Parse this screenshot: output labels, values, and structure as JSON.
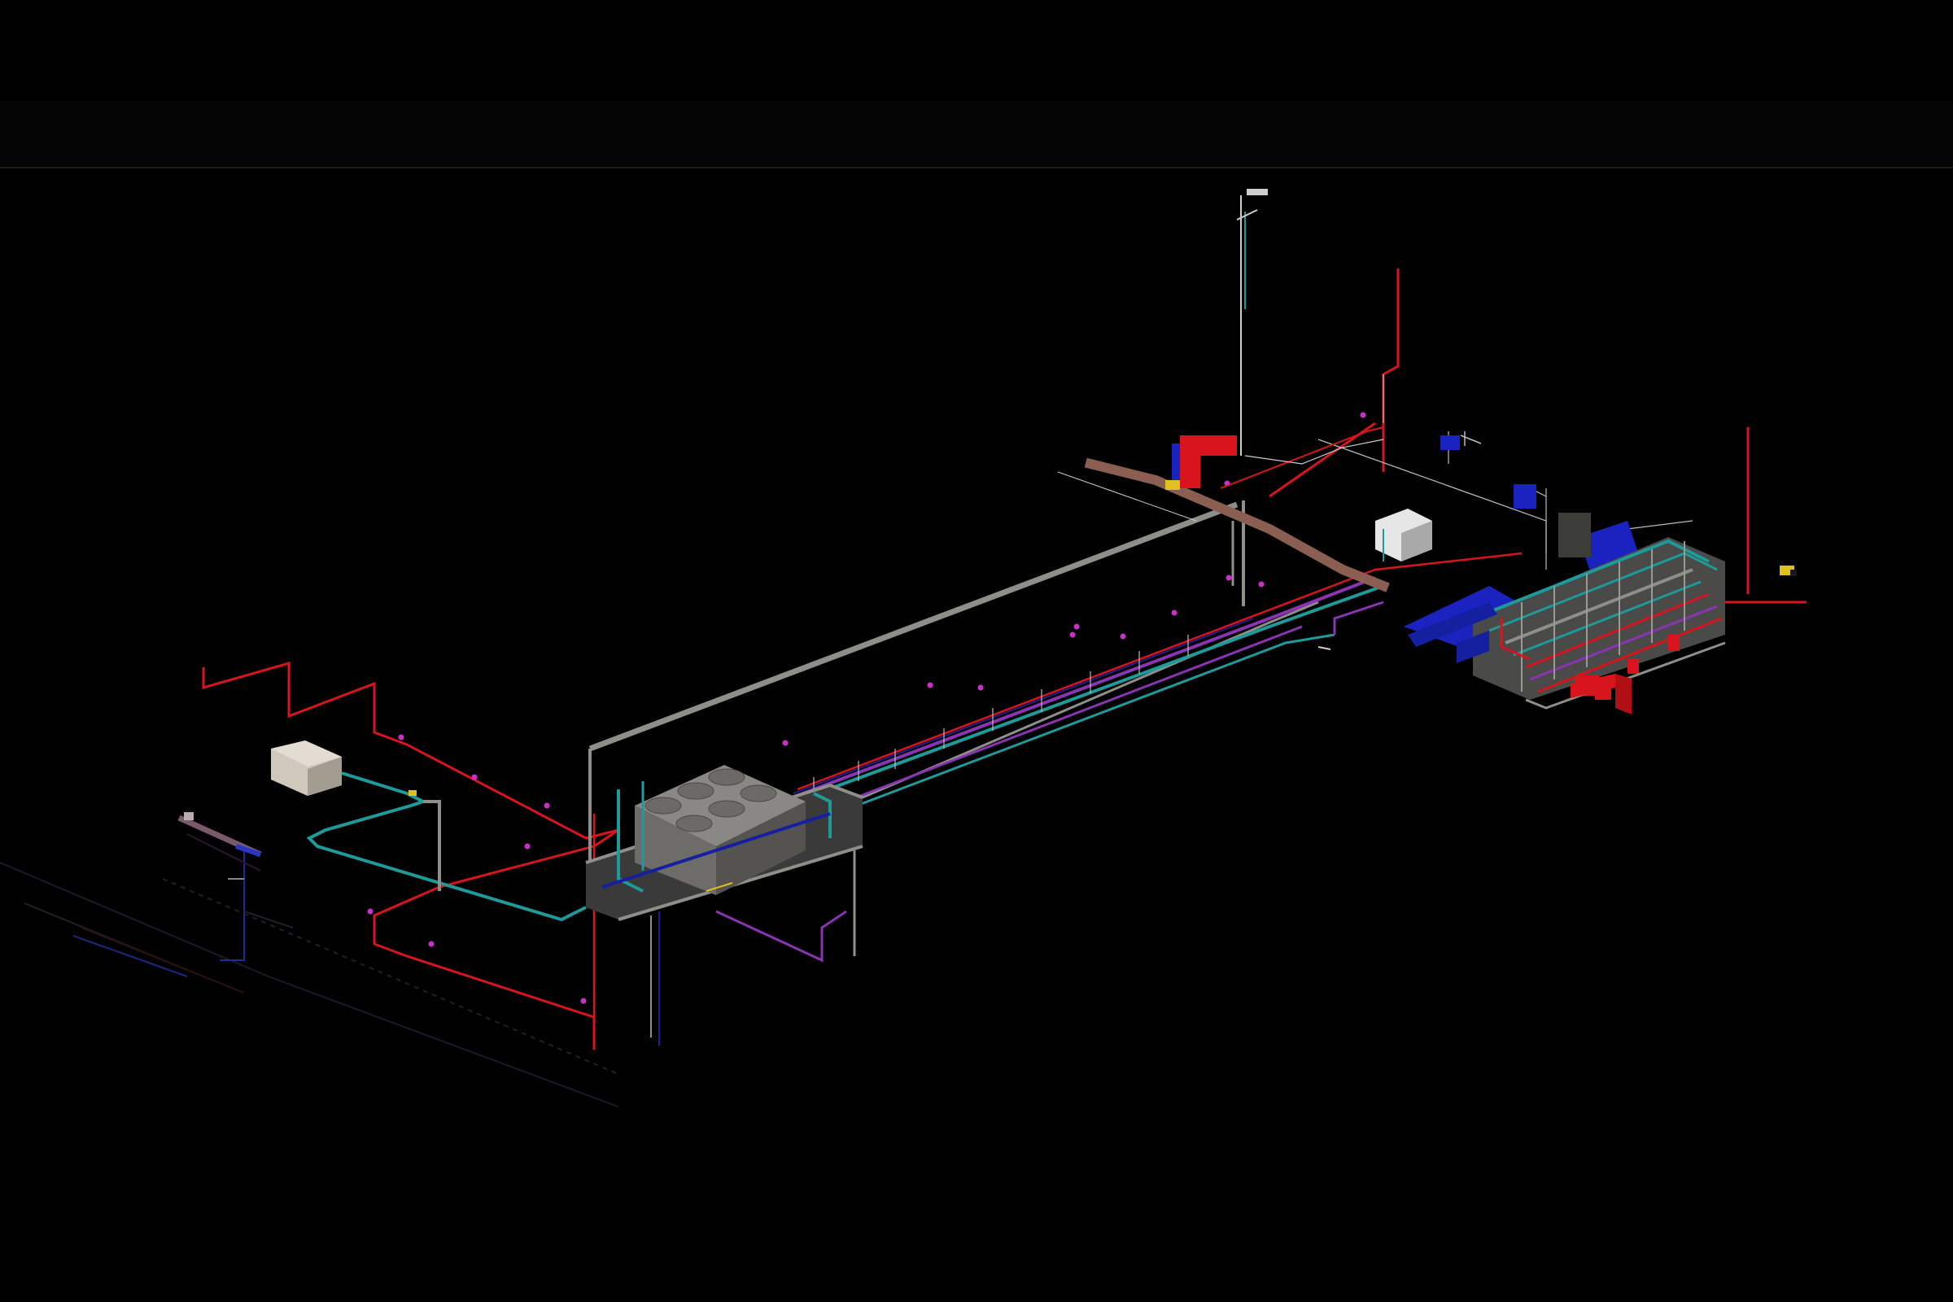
{
  "viewport": {
    "background": "#000000",
    "band_color": "#050505",
    "band_line_color": "#1a1a10"
  },
  "colors": {
    "fire_riser_red": "#d8141c",
    "grey_pipe": "#8f8f8a",
    "teal_pipe": "#1e9a9a",
    "purple_pipe": "#8a34b4",
    "navy_pipe": "#1420a0",
    "magenta_node": "#c830c8",
    "duct_brown": "#8a5e50",
    "equipment_grey": "#7a7a74",
    "tank_beige": "#cfc8bc",
    "blue_unit": "#1a22c0",
    "yellow_tag": "#e0c020",
    "white_lines": "#cccccc"
  },
  "components": [
    {
      "name": "cooling-tower",
      "kind": "equipment"
    },
    {
      "name": "storage-tank",
      "kind": "equipment"
    },
    {
      "name": "plant-room",
      "kind": "equipment"
    },
    {
      "name": "air-handler-red",
      "kind": "equipment"
    },
    {
      "name": "fire-riser-zigzag",
      "kind": "pipe"
    },
    {
      "name": "vertical-mast",
      "kind": "structure"
    },
    {
      "name": "utility-corridor",
      "kind": "pipe-run"
    }
  ]
}
